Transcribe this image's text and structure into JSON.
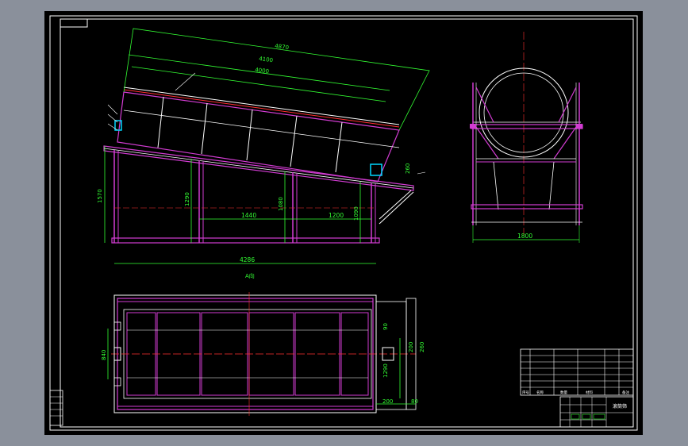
{
  "colors": {
    "background": "#8a909b",
    "sheet": "#000000",
    "border": "#ffffff",
    "frame": "#d23cd2",
    "dimension": "#33ff33",
    "centerline": "#ff3030",
    "accent": "#00d8ff"
  },
  "front_view": {
    "dims": {
      "top_total": "4870",
      "top_mid": "4100",
      "top_inner": "4000",
      "bottom_total": "4286",
      "span_a": "1440",
      "span_b": "1200",
      "height_total": "1570",
      "height_mid": "1290",
      "height_inner": "1080",
      "height_right": "1090",
      "small_right": "260"
    },
    "view_label": "A向"
  },
  "side_view": {
    "dims": {
      "width": "1800"
    }
  },
  "plan_view": {
    "dims": {
      "width_left": "840",
      "right_a": "260",
      "right_b": "200",
      "right_c": "90",
      "right_d": "1290",
      "bottom_a": "200",
      "bottom_b": "80"
    }
  },
  "title_block": {
    "name": "滚筒筛",
    "headers": [
      "序号",
      "名称",
      "数量",
      "材料",
      "备注"
    ]
  }
}
